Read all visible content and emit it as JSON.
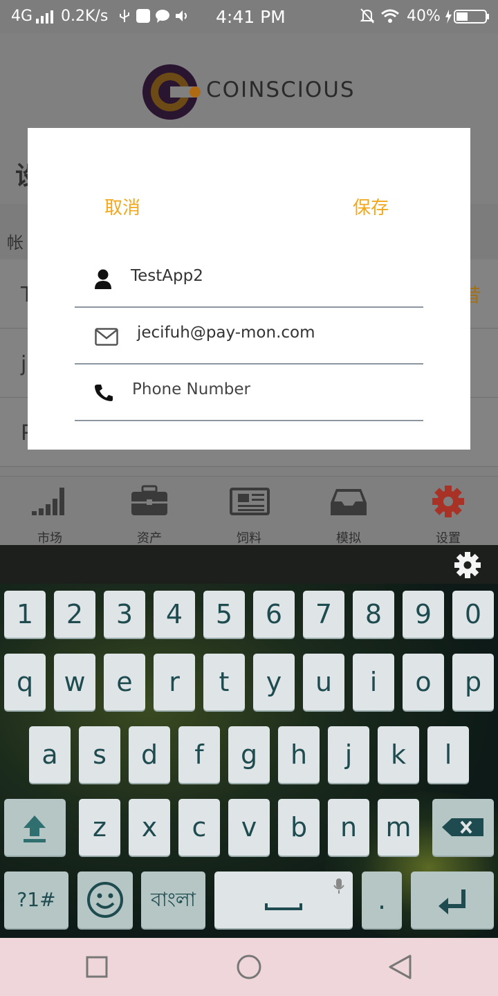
{
  "status_bar": {
    "network": "4G",
    "speed": "0.2K/s",
    "time": "4:41 PM",
    "battery": "40%"
  },
  "header": {
    "logo_text": "COINSCIOUS"
  },
  "background": {
    "title_partial": "设",
    "section_partial": "帐",
    "row1_partial": "T",
    "row2_partial": "je",
    "row3_partial": "P",
    "row1_right_partial": "昔"
  },
  "tabs": [
    {
      "label": "市场",
      "icon": "signal-bars-icon"
    },
    {
      "label": "资产",
      "icon": "briefcase-icon"
    },
    {
      "label": "饲料",
      "icon": "newspaper-icon"
    },
    {
      "label": "模拟",
      "icon": "inbox-tray-icon"
    },
    {
      "label": "设置",
      "icon": "gear-icon"
    }
  ],
  "dialog": {
    "cancel_label": "取消",
    "save_label": "保存",
    "username_value": "TestApp2",
    "email_value": "jecifuh@pay-mon.com",
    "phone_placeholder": "Phone Number"
  },
  "keyboard": {
    "row_numbers": [
      "1",
      "2",
      "3",
      "4",
      "5",
      "6",
      "7",
      "8",
      "9",
      "0"
    ],
    "row_top": [
      "q",
      "w",
      "e",
      "r",
      "t",
      "y",
      "u",
      "i",
      "o",
      "p"
    ],
    "row_mid": [
      "a",
      "s",
      "d",
      "f",
      "g",
      "h",
      "j",
      "k",
      "l"
    ],
    "row_bottom": [
      "z",
      "x",
      "c",
      "v",
      "b",
      "n",
      "m"
    ],
    "symbols_label": "?1#",
    "language_label": "বাংলা",
    "period_label": "."
  },
  "colors": {
    "accent": "#f2a81d",
    "active_tab": "#c0392b",
    "keyboard_text": "#1e4b4f"
  }
}
